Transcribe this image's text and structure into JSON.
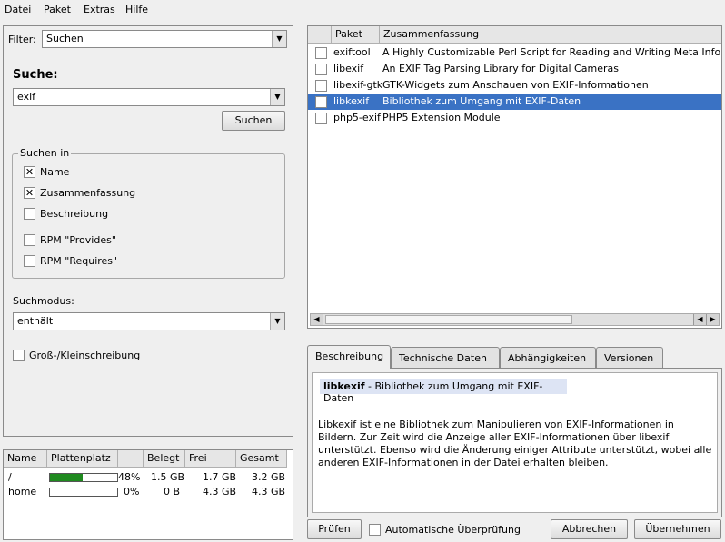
{
  "menu": {
    "items": [
      {
        "label": "Datei"
      },
      {
        "label": "Paket"
      },
      {
        "label": "Extras"
      },
      {
        "label": "Hilfe"
      }
    ]
  },
  "left": {
    "filter_label": "Filter:",
    "filter_value": "Suchen",
    "search_heading": "Suche:",
    "search_value": "exif",
    "search_button": "Suchen",
    "search_in_title": "Suchen in",
    "search_in": [
      {
        "label": "Name",
        "checked": true
      },
      {
        "label": "Zusammenfassung",
        "checked": true
      },
      {
        "label": "Beschreibung",
        "checked": false
      },
      {
        "label": "RPM \"Provides\"",
        "checked": false
      },
      {
        "label": "RPM \"Requires\"",
        "checked": false
      }
    ],
    "mode_label": "Suchmodus:",
    "mode_value": "enthält",
    "case_label": "Groß-/Kleinschreibung",
    "case_checked": false
  },
  "disk": {
    "headers": [
      "Name",
      "Plattenplatz",
      "",
      "Belegt",
      "Frei",
      "Gesamt"
    ],
    "rows": [
      {
        "name": "/",
        "percent": "48%",
        "used": "1.5 GB",
        "free": "1.7 GB",
        "total": "3.2 GB",
        "fill": 0.48
      },
      {
        "name": "home",
        "percent": "0%",
        "used": "0 B",
        "free": "4.3 GB",
        "total": "4.3 GB",
        "fill": 0.0
      }
    ]
  },
  "packages": {
    "headers": [
      "",
      "Paket",
      "Zusammenfassung"
    ],
    "rows": [
      {
        "name": "exiftool",
        "summary": "A Highly Customizable Perl Script for Reading and Writing Meta Informa",
        "selected": false
      },
      {
        "name": "libexif",
        "summary": "An EXIF Tag Parsing Library for Digital Cameras",
        "selected": false
      },
      {
        "name": "libexif-gtk",
        "summary": "GTK-Widgets zum Anschauen von EXIF-Informationen",
        "selected": false
      },
      {
        "name": "libkexif",
        "summary": "Bibliothek zum Umgang mit EXIF-Daten",
        "selected": true
      },
      {
        "name": "php5-exif",
        "summary": "PHP5 Extension Module",
        "selected": false
      }
    ]
  },
  "tabs": [
    {
      "label": "Beschreibung",
      "active": true
    },
    {
      "label": "Technische Daten",
      "active": false
    },
    {
      "label": "Abhängigkeiten",
      "active": false
    },
    {
      "label": "Versionen",
      "active": false
    }
  ],
  "description": {
    "pkg_name": "libkexif",
    "pkg_summary": " - Bibliothek zum Umgang mit EXIF-Daten",
    "body": "Libkexif ist eine Bibliothek zum Manipulieren von EXIF-Informationen in Bildern. Zur Zeit wird die Anzeige aller EXIF-Informationen über libexif unterstützt. Ebenso wird die Änderung einiger Attribute unterstützt, wobei alle anderen EXIF-Informationen in der Datei erhalten bleiben."
  },
  "bottom": {
    "check_button": "Prüfen",
    "auto_check_label": "Automatische Überprüfung",
    "cancel_button": "Abbrechen",
    "accept_button": "Übernehmen"
  },
  "colors": {
    "selection": "#3a72c4",
    "progress": "#1f8a1f"
  }
}
